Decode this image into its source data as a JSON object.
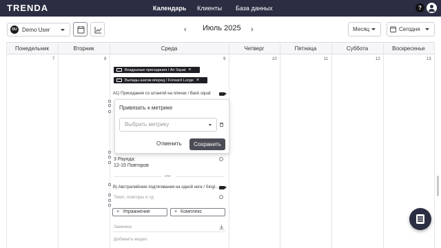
{
  "app": {
    "logo": "TRENDA"
  },
  "nav": {
    "items": [
      "Календарь",
      "Клиенты",
      "База данных"
    ],
    "help": "?"
  },
  "toolbar": {
    "user": {
      "initials": "DU",
      "name": "Demo User"
    },
    "month_title": "Июль 2025",
    "prev": "‹",
    "next": "›",
    "view_mode": "Месяц",
    "today": "Сегодня"
  },
  "calendar": {
    "days": [
      "Понедельник",
      "Вторник",
      "Среда",
      "Четверг",
      "Пятница",
      "Суббота",
      "Воскресенье"
    ],
    "dates": [
      "7",
      "8",
      "9",
      "10",
      "11",
      "12",
      "13"
    ]
  },
  "wednesday": {
    "chips": [
      "Воздушные приседания / Air Squat",
      "Выпады шагом вперед / Forward Lunge"
    ],
    "exercise_a": "A1) Приседания со штангой на плечах / Back squat",
    "rounds": "3 Раунда:",
    "reps": "12-15 Повторов",
    "or_label": "или",
    "exercise_b": "B) Австралийские подтягивания на одной ноге / Singl...",
    "tempo_placeholder": "Темп, повторы и тд",
    "add_exercise": "Упражнение",
    "add_complex": "Комплекс",
    "cooldown": "Заминка",
    "add_video": "Добавить видео"
  },
  "popup": {
    "title": "Привязать к метрике",
    "select_placeholder": "Выбрать метрику",
    "cancel": "Отменить",
    "save": "Сохранить"
  },
  "colors": {
    "nav_bg": "#2b2d42",
    "chip_bg": "#1e1f24",
    "save_bg": "#4b4c55"
  }
}
